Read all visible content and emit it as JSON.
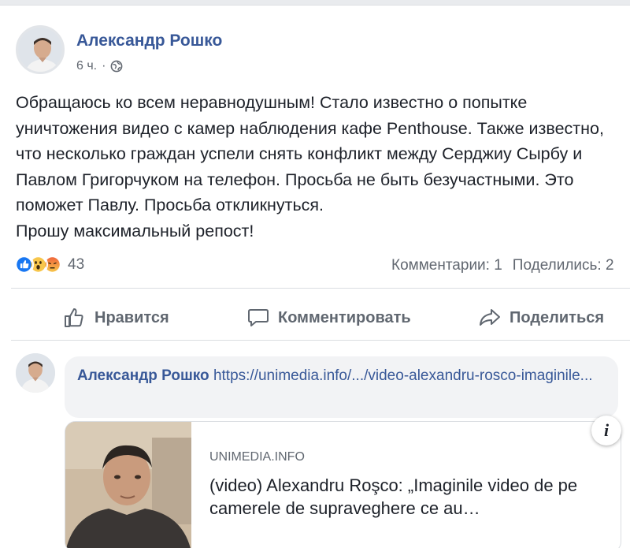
{
  "post": {
    "author": "Александр Рошко",
    "time": "6 ч.",
    "separator": "·",
    "privacy_icon": "globe-icon",
    "text_lines": [
      "Обращаюсь ко всем неравнодушным! Стало известно о попытке",
      "уничтожения видео с камер наблюдения кафе Penthouse. Также известно,",
      "что несколько граждан успели снять конфликт между Серджиу Сырбу и",
      "Павлом Григорчуком на телефон. Просьба не быть безучастными. Это",
      "поможет Павлу. Просьба откликнуться.",
      "Прошу максимальный репост!"
    ]
  },
  "reactions": {
    "icons": [
      "like-reaction-icon",
      "wow-reaction-icon",
      "angry-reaction-icon"
    ],
    "count": "43",
    "comments": "Комментарии: 1",
    "shares": "Поделились: 2"
  },
  "actions": {
    "like": "Нравится",
    "comment": "Комментировать",
    "share": "Поделиться"
  },
  "comment": {
    "author": "Александр Рошко",
    "link_text": "https://unimedia.info/.../video-alexandru-rosco-imaginile..."
  },
  "link_preview": {
    "domain": "UNIMEDIA.INFO",
    "title": "(video) Alexandru Roşco: „Imaginile video de pe camerele de supraveghere ce au…",
    "info_label": "i"
  },
  "colors": {
    "link_blue": "#385898",
    "text": "#1d2129",
    "muted": "#606770",
    "like_blue": "#1877f2",
    "reaction_yellow": "#f7c64b",
    "angry_orange": "#f0653a"
  }
}
